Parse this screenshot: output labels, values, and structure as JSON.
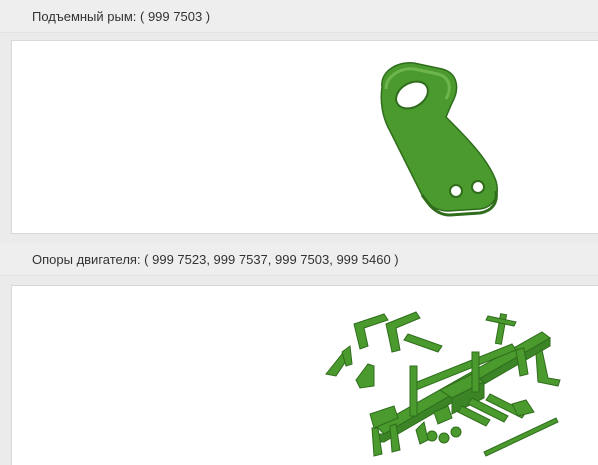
{
  "sections": [
    {
      "title": "Подъемный рым: ( 999 7503 )",
      "image": "lifting-eye-part"
    },
    {
      "title": "Опоры двигателя: ( 999 7523, 999 7537, 999 7503, 999 5460 )",
      "image": "engine-mounts-assembly"
    }
  ],
  "colors": {
    "part_green": "#4a9a2e",
    "part_green_dark": "#2f6d1c",
    "part_green_light": "#7cc25a",
    "header_bg": "#eeeeee",
    "panel_bg": "#ffffff"
  }
}
